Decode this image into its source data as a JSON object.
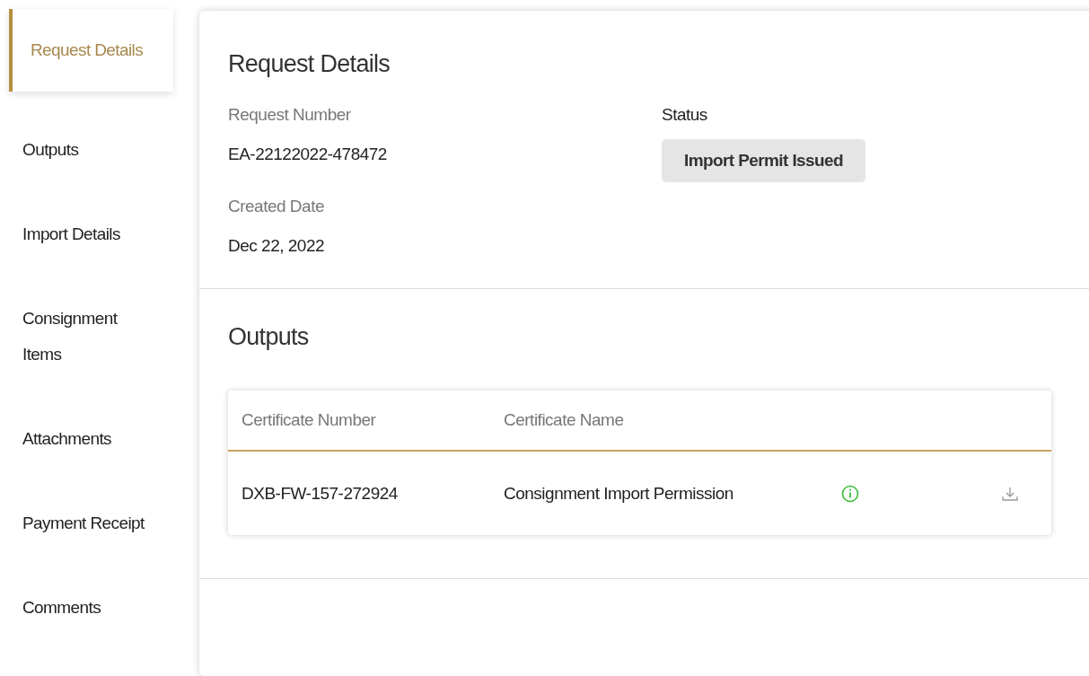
{
  "sidebar": {
    "items": [
      {
        "label": "Request Details",
        "selected": true
      },
      {
        "label": "Outputs",
        "selected": false
      },
      {
        "label": "Import Details",
        "selected": false
      },
      {
        "label": "Consignment Items",
        "selected": false
      },
      {
        "label": "Attachments",
        "selected": false
      },
      {
        "label": "Payment Receipt",
        "selected": false
      },
      {
        "label": "Comments",
        "selected": false
      }
    ]
  },
  "request_details": {
    "title": "Request Details",
    "fields": [
      {
        "label": "Request Number",
        "value": "EA-22122022-478472"
      },
      {
        "label": "Created Date",
        "value": "Dec 22, 2022"
      }
    ],
    "status": {
      "label": "Status",
      "value": "Import Permit Issued"
    }
  },
  "outputs": {
    "title": "Outputs",
    "table": {
      "columns": [
        "Certificate Number",
        "Certificate Name"
      ],
      "rows": [
        {
          "cells": [
            "DXB-FW-157-272924",
            "Consignment Import Permission"
          ]
        }
      ]
    }
  }
}
